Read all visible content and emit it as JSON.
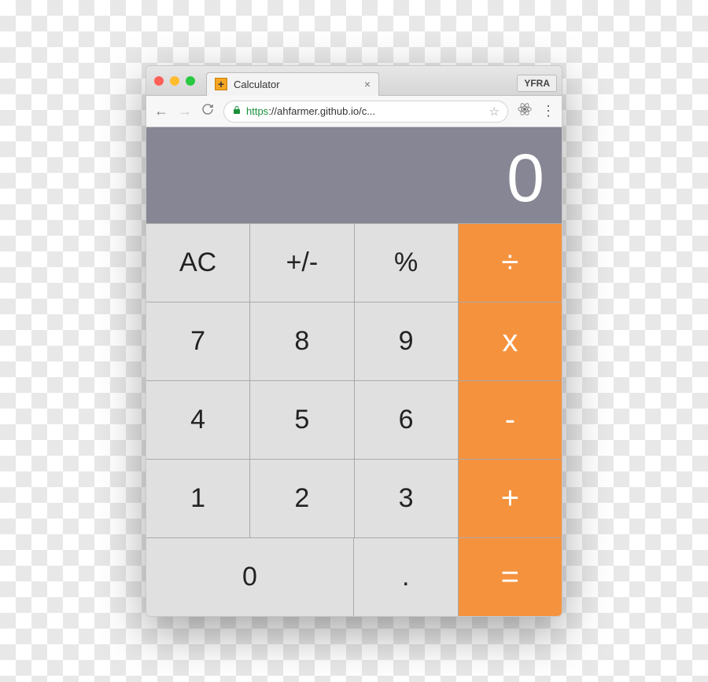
{
  "browser": {
    "tab_title": "Calculator",
    "extension_text": "YFRA",
    "url_scheme": "https",
    "url_host_path": "://ahfarmer.github.io/c..."
  },
  "calc": {
    "display": "0",
    "rows": [
      [
        {
          "label": "AC",
          "name": "clear-button",
          "op": false,
          "wide": false
        },
        {
          "label": "+/-",
          "name": "negate-button",
          "op": false,
          "wide": false
        },
        {
          "label": "%",
          "name": "percent-button",
          "op": false,
          "wide": false
        },
        {
          "label": "÷",
          "name": "divide-button",
          "op": true,
          "wide": false
        }
      ],
      [
        {
          "label": "7",
          "name": "digit-7-button",
          "op": false,
          "wide": false
        },
        {
          "label": "8",
          "name": "digit-8-button",
          "op": false,
          "wide": false
        },
        {
          "label": "9",
          "name": "digit-9-button",
          "op": false,
          "wide": false
        },
        {
          "label": "x",
          "name": "multiply-button",
          "op": true,
          "wide": false
        }
      ],
      [
        {
          "label": "4",
          "name": "digit-4-button",
          "op": false,
          "wide": false
        },
        {
          "label": "5",
          "name": "digit-5-button",
          "op": false,
          "wide": false
        },
        {
          "label": "6",
          "name": "digit-6-button",
          "op": false,
          "wide": false
        },
        {
          "label": "-",
          "name": "subtract-button",
          "op": true,
          "wide": false
        }
      ],
      [
        {
          "label": "1",
          "name": "digit-1-button",
          "op": false,
          "wide": false
        },
        {
          "label": "2",
          "name": "digit-2-button",
          "op": false,
          "wide": false
        },
        {
          "label": "3",
          "name": "digit-3-button",
          "op": false,
          "wide": false
        },
        {
          "label": "+",
          "name": "add-button",
          "op": true,
          "wide": false
        }
      ],
      [
        {
          "label": "0",
          "name": "digit-0-button",
          "op": false,
          "wide": true
        },
        {
          "label": ".",
          "name": "decimal-button",
          "op": false,
          "wide": false
        },
        {
          "label": "=",
          "name": "equals-button",
          "op": true,
          "wide": false
        }
      ]
    ]
  }
}
